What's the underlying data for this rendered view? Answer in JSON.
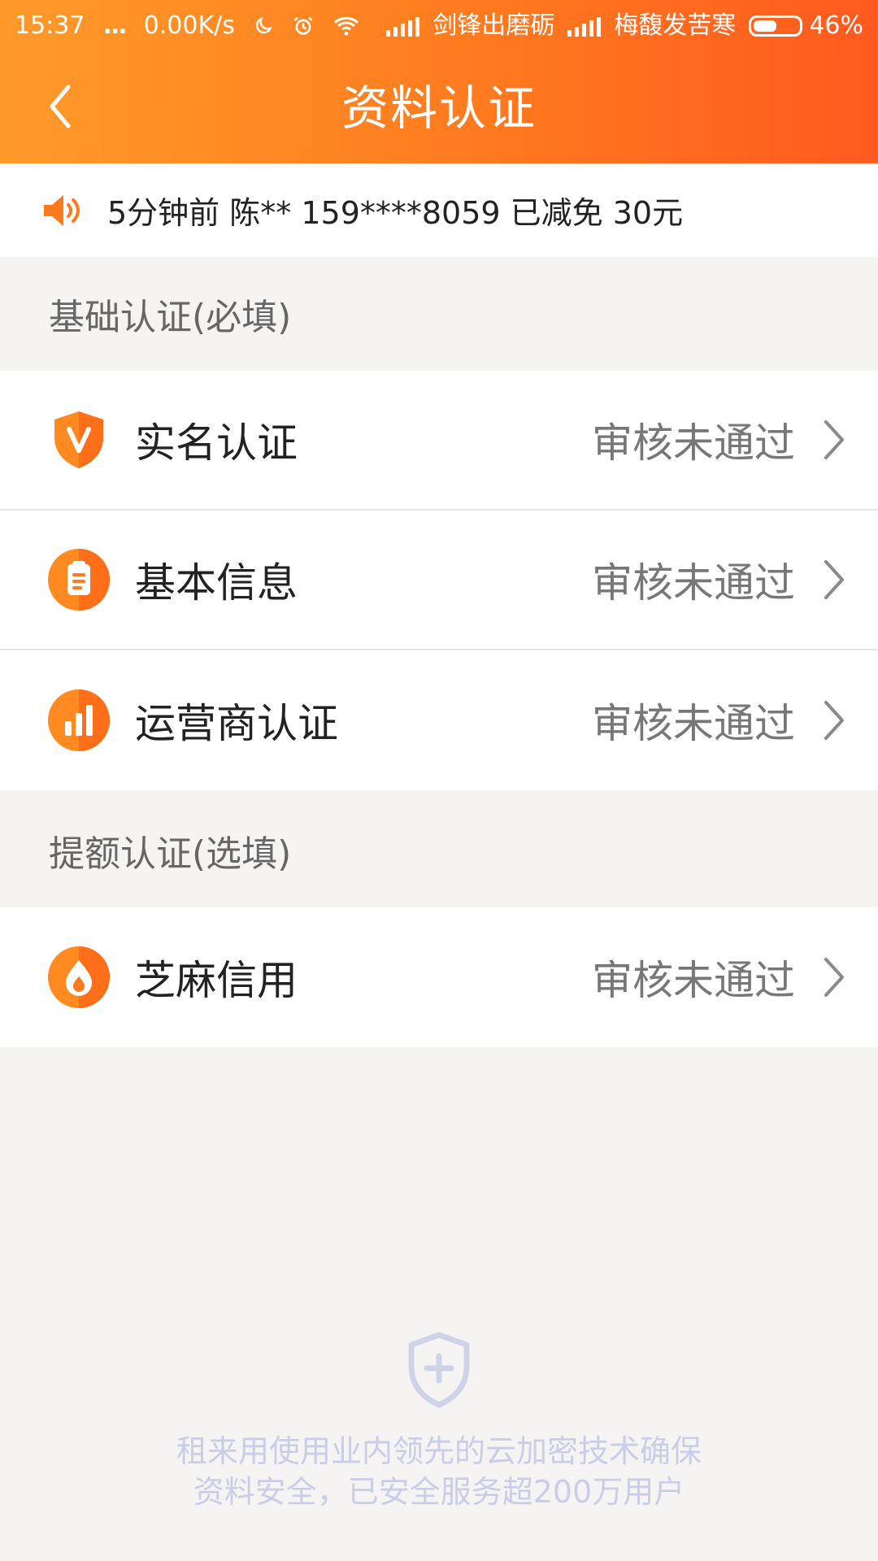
{
  "status_bar": {
    "time": "15:37",
    "dots": "...",
    "speed": "0.00K/s",
    "carrier_1": "剑锋出磨砺",
    "carrier_2": "梅馥发苦寒",
    "battery": "46%",
    "battery_level": 0.46
  },
  "header": {
    "title": "资料认证"
  },
  "notice": {
    "text": "5分钟前 陈** 159****8059 已减免 30元"
  },
  "sections": {
    "basic": {
      "title": "基础认证(必填)",
      "items": [
        {
          "label": "实名认证",
          "status": "审核未通过"
        },
        {
          "label": "基本信息",
          "status": "审核未通过"
        },
        {
          "label": "运营商认证",
          "status": "审核未通过"
        }
      ]
    },
    "boost": {
      "title": "提额认证(选填)",
      "items": [
        {
          "label": "芝麻信用",
          "status": "审核未通过"
        }
      ]
    }
  },
  "footer": {
    "line1": "租来用使用业内领先的云加密技术确保",
    "line2": "资料安全，已安全服务超200万用户"
  },
  "colors": {
    "accent": "#ff7a1f",
    "header_gradient_start": "#ff9a2a",
    "header_gradient_end": "#ff5a1f",
    "background": "#f5f4f3",
    "footer_text": "#c9cde7"
  },
  "icons": {
    "back": "chevron-left-icon",
    "speaker": "speaker-icon",
    "shield_v": "shield-v-icon",
    "clipboard": "clipboard-icon",
    "bars": "bar-chart-icon",
    "sesame": "sesame-flame-icon",
    "chevron_right": "chevron-right-icon",
    "footer_shield": "shield-plus-icon"
  }
}
